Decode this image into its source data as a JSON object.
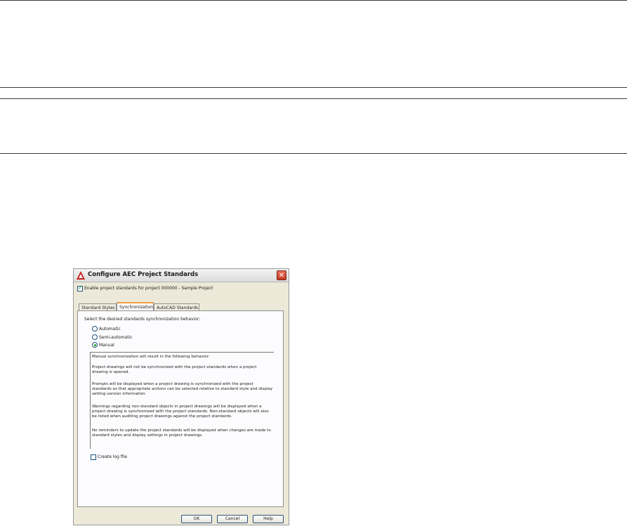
{
  "dialog": {
    "title": "Configure AEC Project Standards",
    "close_label": "✕",
    "enable_checkbox_label": "Enable project standards for project 000000 - Sample Project",
    "enable_checked": true
  },
  "tabs": [
    {
      "label": "Standard Styles",
      "active": false
    },
    {
      "label": "Synchronization",
      "active": true
    },
    {
      "label": "AutoCAD Standards",
      "active": false
    }
  ],
  "sync": {
    "prompt": "Select the desired standards synchronization behavior:",
    "options": [
      "Automatic",
      "Semi-automatic",
      "Manual"
    ],
    "selected": "Manual",
    "description": [
      "Manual synchronization will result in the following behavior:",
      "Project drawings will not be synchronized with the project standards when a project drawing is opened.",
      "Prompts will be displayed when a project drawing is synchronized with the project standards so that appropriate actions can be selected relative to standard style and display setting version information.",
      "Warnings regarding non-standard objects in project drawings will be displayed when a project drawing is synchronized with the project standards. Non-standard objects will also be listed when auditing project drawings against the project standards.",
      "No reminders to update the project standards will be displayed when changes are made to standard styles and display settings in project drawings."
    ],
    "log_label": "Create log file",
    "log_checked": false
  },
  "buttons": {
    "ok": "OK",
    "cancel": "Cancel",
    "help": "Help"
  }
}
